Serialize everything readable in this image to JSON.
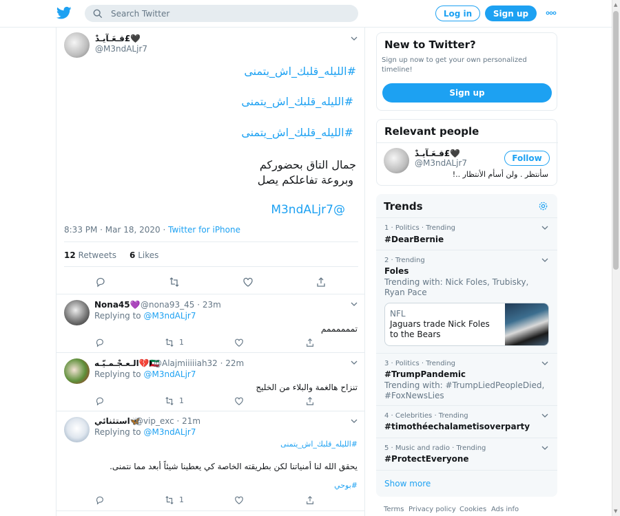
{
  "header": {
    "search_placeholder": "Search Twitter",
    "login_label": "Log in",
    "signup_label": "Sign up",
    "brand_color": "#1da1f2"
  },
  "main_tweet": {
    "author_name": "قـعَـآيـدْ£🖤",
    "author_handle": "@M3ndALjr7",
    "lines": [
      "#الليله_قلبك_اش_يتمنى",
      "#الليله_قلبك_اش_يتمنى",
      "#الليله_قلبك_اش_يتمنى",
      "جمال التاق بحضوركم",
      "وبروعة تفاعلكم يصل",
      "@M3ndALjr7"
    ],
    "time": "8:33 PM · Mar 18, 2020 · ",
    "source": "Twitter for iPhone",
    "retweets": "12",
    "retweets_label": "Retweets",
    "likes": "6",
    "likes_label": "Likes"
  },
  "replies": [
    {
      "name": "Nona45💜",
      "handle": "@nona93_45 · 23m",
      "replying_prefix": "Replying to ",
      "replying_to": "@M3ndALjr7",
      "text": "تممممممم",
      "retweets": "1"
    },
    {
      "name": "الـعـجْـمـيّـه💔🇰🇼",
      "handle": "@Alajmiiiiiah32 · 22m",
      "replying_prefix": "Replying to ",
      "replying_to": "@M3ndALjr7",
      "text": "تنزاح هالغمة والبلاء من الخليج",
      "retweets": "1"
    },
    {
      "name": "استثنائي🦋",
      "handle": "@vip_exc · 21m",
      "replying_prefix": "Replying to ",
      "replying_to": "@M3ndALjr7",
      "hashtag": "#الليله_قلبك_اش_يتمنى",
      "text": "يحقق الله لنا أمنياتنا لكن بطريقته الخاصة كي يعطينا شيئاً أبعد مما نتمنى.",
      "hashtag2": "#بوحي",
      "retweets": "1"
    }
  ],
  "new_to_twitter": {
    "title": "New to Twitter?",
    "text": "Sign up now to get your own personalized timeline!",
    "button": "Sign up"
  },
  "relevant_people": {
    "title": "Relevant people",
    "name": "قـعَـآيـدْ£🖤",
    "handle": "@M3ndALjr7",
    "follow": "Follow",
    "bio": "سأنتظر . ولن أسأم الأنتظار ..!"
  },
  "trends": {
    "title": "Trends",
    "items": [
      {
        "meta": "1 · Politics · Trending",
        "name": "#DearBernie"
      },
      {
        "meta": "2 · Trending",
        "name": "Foles",
        "with": "Trending with: Nick Foles, Trubisky, Ryan Pace",
        "news_category": "NFL",
        "news_text": "Jaguars trade Nick Foles to the Bears"
      },
      {
        "meta": "3 · Politics · Trending",
        "name": "#TrumpPandemic",
        "with": "Trending with: #TrumpLiedPeopleDied, #FoxNewsLies"
      },
      {
        "meta": "4 · Celebrities · Trending",
        "name": "#timothéechalametisoverparty"
      },
      {
        "meta": "5 · Music and radio · Trending",
        "name": "#ProtectEveryone"
      }
    ],
    "show_more": "Show more"
  },
  "footer": [
    "Terms",
    "Privacy policy",
    "Cookies",
    "Ads info"
  ]
}
